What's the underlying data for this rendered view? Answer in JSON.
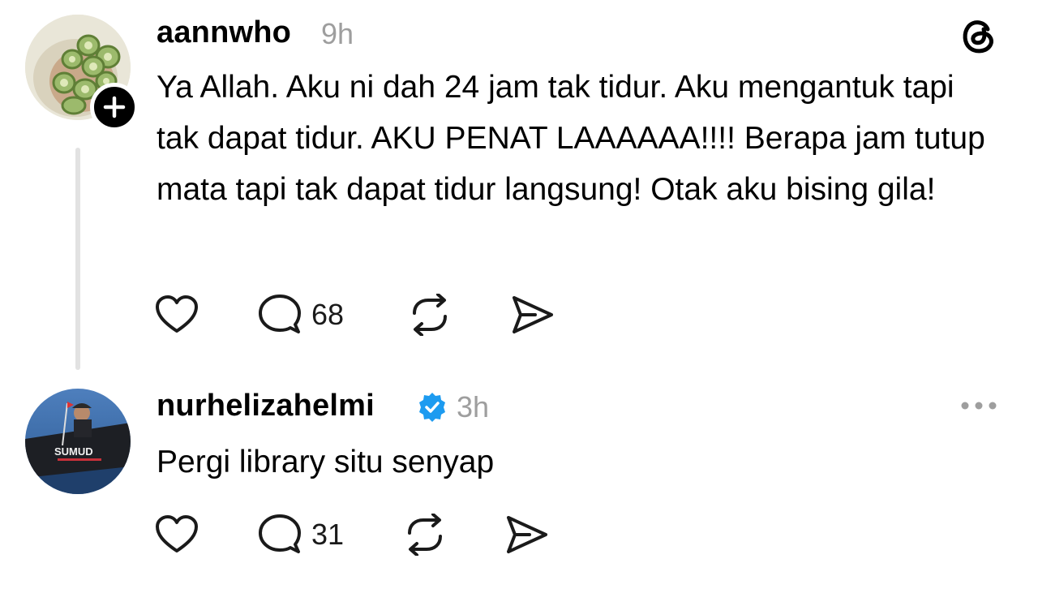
{
  "app": {
    "logo_icon": "threads-logo-icon"
  },
  "posts": [
    {
      "username": "aannwho",
      "time": "9h",
      "text": "Ya Allah. Aku ni dah 24 jam tak tidur. Aku mengantuk tapi tak dapat tidur. AKU PENAT LAAAAAA!!!! Berapa jam tutup mata tapi tak dapat tidur langsung! Otak aku bising gila!",
      "likes": "",
      "replies": "68",
      "follow_icon": "plus-icon"
    },
    {
      "username": "nurhelizahelmi",
      "verified": true,
      "time": "3h",
      "text": "Pergi library situ senyap",
      "likes": "",
      "replies": "31",
      "menu_icon": "more-horizontal-icon",
      "avatar_text": "SUMUD"
    }
  ],
  "colors": {
    "verified": "#1d9bf0",
    "muted": "#9e9e9e",
    "thread_line": "#e2e2e2"
  }
}
